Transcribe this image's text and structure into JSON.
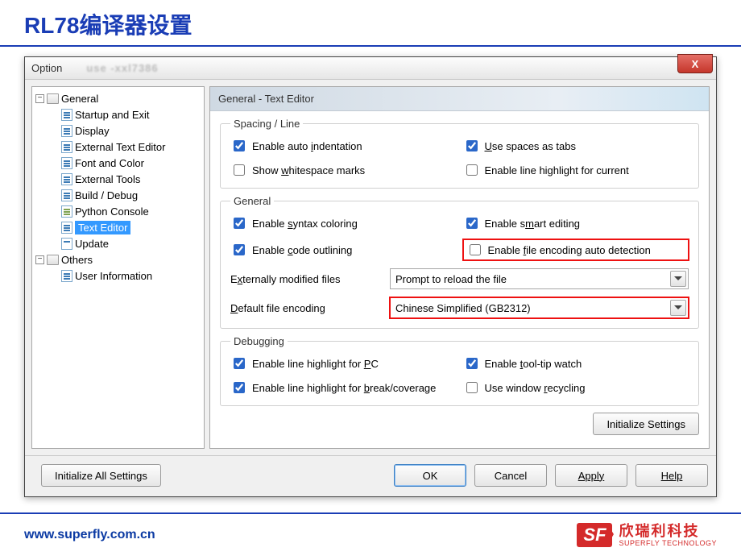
{
  "slide": {
    "title": "RL78编译器设置",
    "url": "www.superfly.com.cn",
    "logo_cn": "欣瑞利科技",
    "logo_en": "SUPERFLY TECHNOLOGY",
    "logo_badge": "SF"
  },
  "dialog": {
    "title": "Option",
    "close_x": "X",
    "footer": {
      "init_all": "Initialize All Settings",
      "ok": "OK",
      "cancel": "Cancel",
      "apply": "Apply",
      "help": "Help"
    }
  },
  "tree": {
    "general": {
      "label": "General",
      "expanded": true,
      "items": [
        "Startup and Exit",
        "Display",
        "External Text Editor",
        "Font and Color",
        "External Tools",
        "Build / Debug",
        "Python Console",
        "Text Editor",
        "Update"
      ],
      "selected_index": 7
    },
    "others": {
      "label": "Others",
      "expanded": true,
      "items": [
        "User Information"
      ]
    }
  },
  "panel": {
    "header": "General - Text Editor",
    "groups": {
      "spacing": {
        "legend": "Spacing / Line",
        "auto_indent": {
          "label_pre": "Enable auto ",
          "u": "i",
          "label_post": "ndentation",
          "checked": true
        },
        "spaces_tabs": {
          "u": "U",
          "label_post": "se spaces as tabs",
          "checked": true
        },
        "whitespace": {
          "label_pre": "Show ",
          "u": "w",
          "label_post": "hitespace marks",
          "checked": false
        },
        "line_highlight": {
          "label": "Enable line highlight for current",
          "checked": false
        }
      },
      "general": {
        "legend": "General",
        "syntax": {
          "label_pre": "Enable ",
          "u": "s",
          "label_post": "yntax coloring",
          "checked": true
        },
        "smart": {
          "label_pre": "Enable s",
          "u": "m",
          "label_post": "art editing",
          "checked": true
        },
        "outline": {
          "label_pre": "Enable ",
          "u": "c",
          "label_post": "ode outlining",
          "checked": true
        },
        "encoding_auto": {
          "label_pre": "Enable ",
          "u": "f",
          "label_post": "ile encoding auto detection",
          "checked": false
        },
        "ext_mod_label_pre": "E",
        "ext_mod_u": "x",
        "ext_mod_label_post": "ternally modified files",
        "ext_mod_value": "Prompt to reload the file",
        "enc_label_pre": "",
        "enc_u": "D",
        "enc_label_post": "efault file encoding",
        "enc_value": "Chinese Simplified (GB2312)"
      },
      "debugging": {
        "legend": "Debugging",
        "pc": {
          "label_pre": "Enable line highlight for ",
          "u": "P",
          "label_post": "C",
          "checked": true
        },
        "tooltip": {
          "label_pre": "Enable ",
          "u": "t",
          "label_post": "ool-tip watch",
          "checked": true
        },
        "break": {
          "label_pre": "Enable line highlight for ",
          "u": "b",
          "label_post": "reak/coverage",
          "checked": true
        },
        "recycle": {
          "label_pre": "Use window ",
          "u": "r",
          "label_post": "ecycling",
          "checked": false
        }
      }
    },
    "init_settings": "Initialize Settings"
  }
}
